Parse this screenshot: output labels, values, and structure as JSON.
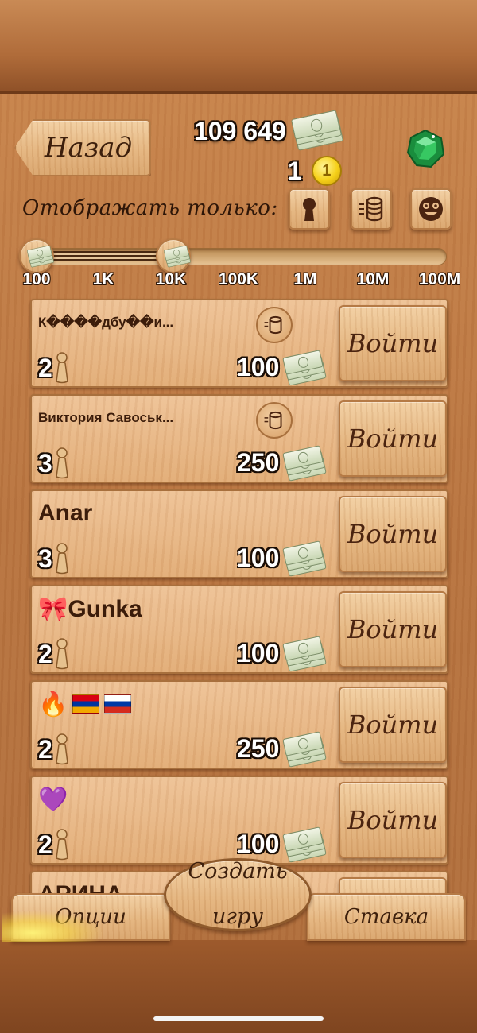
{
  "header": {
    "back_label": "Назад",
    "money_amount": "109 649",
    "chips_amount": "1",
    "gold_coin_label": "1",
    "money_icon": "banknotes-icon",
    "gem_icon": "emerald-gem-icon"
  },
  "filter": {
    "label": "Отображать только:",
    "buttons": [
      {
        "icon": "keyhole-icon"
      },
      {
        "icon": "chip-stack-icon"
      },
      {
        "icon": "smiley-face-icon"
      }
    ]
  },
  "bet_range": {
    "ticks": [
      "100",
      "1K",
      "10K",
      "100K",
      "1M",
      "10M",
      "100M"
    ],
    "min_value": "100",
    "max_value": "10K"
  },
  "games": [
    {
      "name": "К����дбу��и...",
      "players": "2",
      "bet": "100",
      "has_cup": true,
      "join_label": "Войти"
    },
    {
      "name": "Виктория Савоськ...",
      "players": "3",
      "bet": "250",
      "has_cup": true,
      "join_label": "Войти"
    },
    {
      "name": "Anar",
      "players": "3",
      "bet": "100",
      "has_cup": false,
      "join_label": "Войти"
    },
    {
      "name": "🎀Gunka",
      "players": "2",
      "bet": "100",
      "has_cup": false,
      "join_label": "Войти"
    },
    {
      "name": "🔥",
      "players": "2",
      "bet": "250",
      "has_cup": false,
      "join_label": "Войти"
    },
    {
      "name": "💜",
      "players": "2",
      "bet": "100",
      "has_cup": false,
      "join_label": "Войти"
    },
    {
      "name": "АРИНА",
      "players": "",
      "bet": "",
      "has_cup": false,
      "join_label": ""
    }
  ],
  "bottom": {
    "options_label": "Опции",
    "create_label_line1": "Создать",
    "create_label_line2": "игру",
    "stake_label": "Ставка"
  },
  "colors": {
    "wood_light": "#e4b47e",
    "wood_dark": "#9a5a2c",
    "text_brown": "#3d1f0c",
    "gold": "#f6d11a",
    "emerald": "#1fa84a"
  }
}
